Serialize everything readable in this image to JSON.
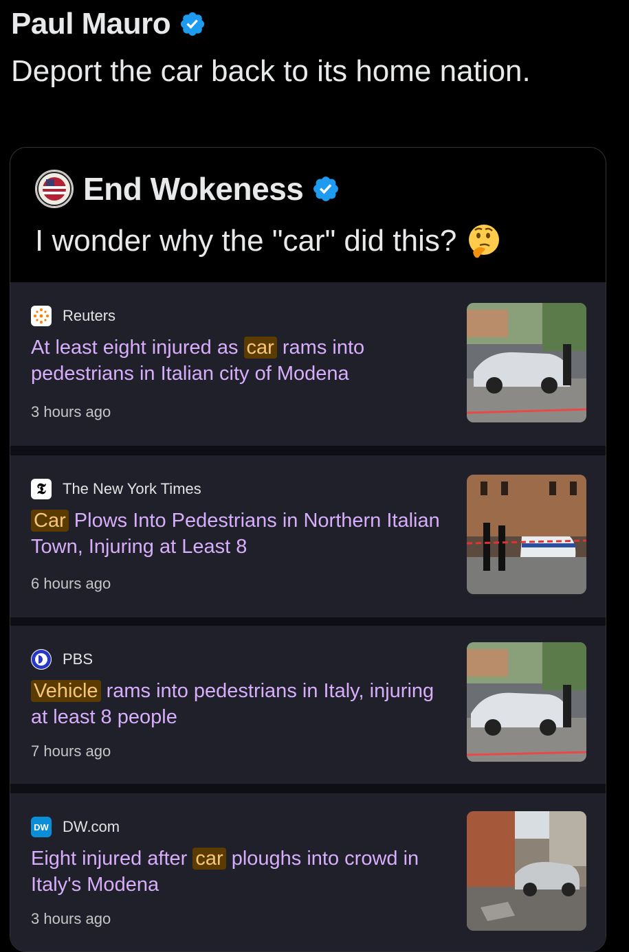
{
  "post": {
    "author": "Paul Mauro",
    "text": "Deport the car back to its home nation."
  },
  "quote": {
    "author": "End Wokeness",
    "text": "I wonder why the \"car\" did this?",
    "emoji": "🤔"
  },
  "news": [
    {
      "source": "Reuters",
      "headline_before": "At least eight injured as ",
      "highlight": "car",
      "headline_after": " rams into pedestrians in Italian city of Modena",
      "time": "3 hours ago"
    },
    {
      "source": "The New York Times",
      "headline_before": "",
      "highlight": "Car",
      "headline_after": " Plows Into Pedestrians in Northern Italian Town, Injuring at Least 8",
      "time": "6 hours ago"
    },
    {
      "source": "PBS",
      "headline_before": "",
      "highlight": "Vehicle",
      "headline_after": " rams into pedestrians in Italy, injuring at least 8 people",
      "time": "7 hours ago"
    },
    {
      "source": "DW.com",
      "headline_before": "Eight injured after ",
      "highlight": "car",
      "headline_after": " ploughs into crowd in Italy's Modena",
      "time": "3 hours ago"
    }
  ],
  "colors": {
    "background": "#000000",
    "verified": "#1d9bf0",
    "headline": "#d7aefb",
    "highlight_bg": "#5c3b00",
    "highlight_fg": "#f6c67a",
    "card": "#1f2029"
  }
}
